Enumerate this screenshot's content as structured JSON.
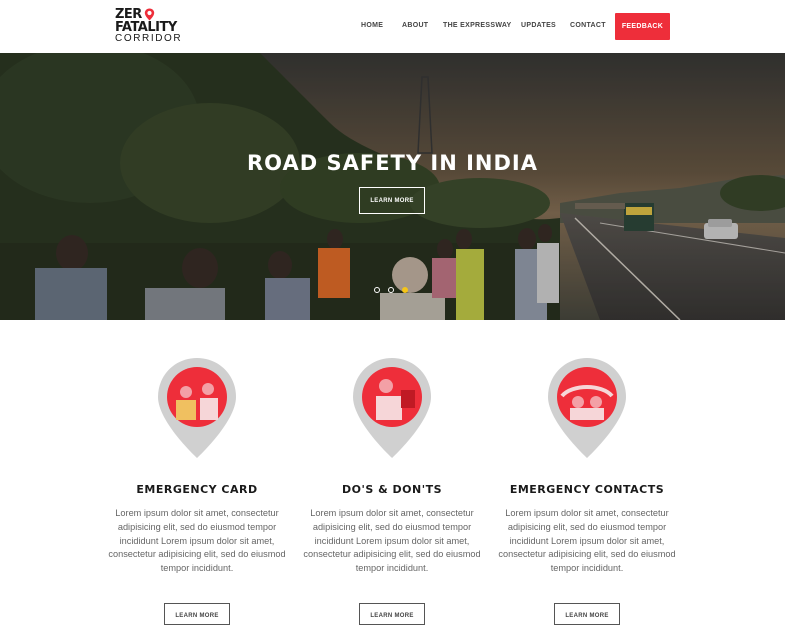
{
  "brand": {
    "line1": "ZER",
    "line2": "FATALITY",
    "line3": "CORRIDOR"
  },
  "nav": {
    "items": [
      "HOME",
      "ABOUT",
      "THE EXPRESSWAY",
      "UPDATES",
      "CONTACT"
    ],
    "feedback": "FEEDBACK"
  },
  "hero": {
    "title": "ROAD SAFETY IN INDIA",
    "button": "LEARN MORE",
    "slides_active": 3
  },
  "features": [
    {
      "title": "EMERGENCY CARD",
      "text": "Lorem ipsum dolor sit amet, consectetur adipisicing elit, sed do eiusmod tempor incididunt Lorem ipsum dolor sit amet, consectetur adipisicing elit, sed do eiusmod tempor incididunt.",
      "button": "LEARN MORE"
    },
    {
      "title": "DO'S & DON'TS",
      "text": "Lorem ipsum dolor sit amet, consectetur adipisicing elit, sed do eiusmod tempor incididunt Lorem ipsum dolor sit amet, consectetur adipisicing elit, sed do eiusmod tempor incididunt.",
      "button": "LEARN MORE"
    },
    {
      "title": "EMERGENCY CONTACTS",
      "text": "Lorem ipsum dolor sit amet, consectetur adipisicing elit, sed do eiusmod tempor incididunt Lorem ipsum dolor sit amet, consectetur adipisicing elit, sed do eiusmod tempor incididunt.",
      "button": "LEARN MORE"
    }
  ],
  "colors": {
    "accent": "#ee2e3a",
    "pin_gray": "#d0d0d0",
    "dot_active": "#f5c518"
  }
}
